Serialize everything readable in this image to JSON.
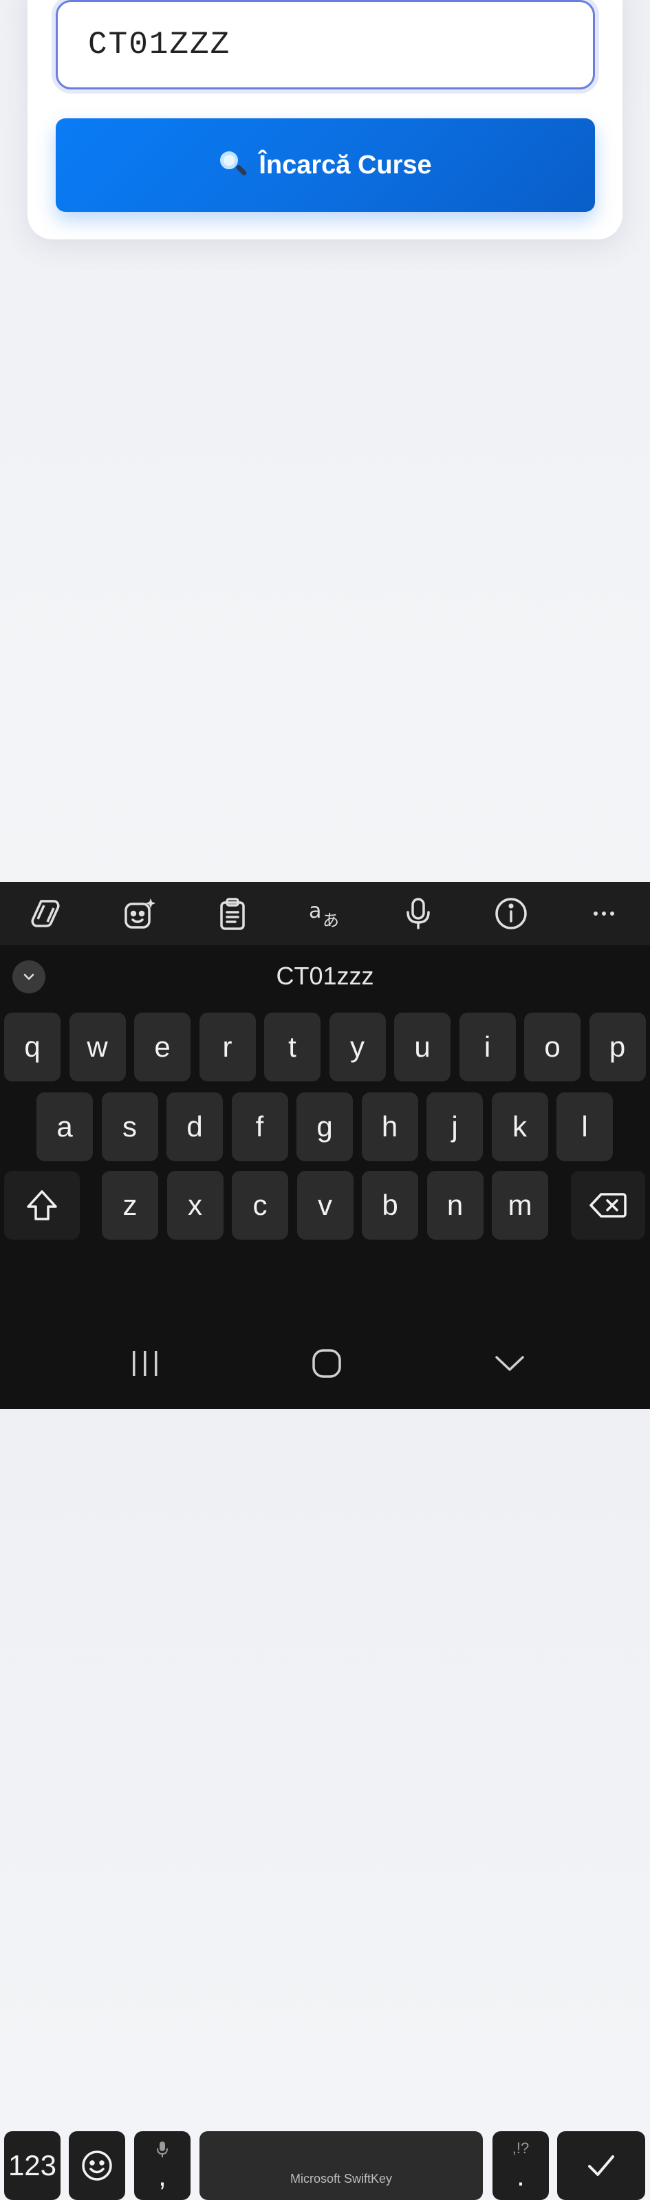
{
  "form": {
    "code_value": "CT01ZZZ",
    "load_button_label": "Încarcă Curse"
  },
  "keyboard": {
    "toolbar_icons": [
      "copilot-icon",
      "sticker-icon",
      "clipboard-icon",
      "translate-icon",
      "microphone-icon",
      "info-icon",
      "more-icon"
    ],
    "suggestion": "CT01zzz",
    "rows": [
      [
        "q",
        "w",
        "e",
        "r",
        "t",
        "y",
        "u",
        "i",
        "o",
        "p"
      ],
      [
        "a",
        "s",
        "d",
        "f",
        "g",
        "h",
        "j",
        "k",
        "l"
      ],
      [
        "z",
        "x",
        "c",
        "v",
        "b",
        "n",
        "m"
      ]
    ],
    "numbers_key": "123",
    "comma_key": ",",
    "space_label": "Microsoft SwiftKey",
    "period_key": ".",
    "period_alt": ",!?"
  },
  "navbar": {
    "buttons": [
      "recent-apps",
      "home",
      "back"
    ]
  },
  "colors": {
    "accent": "#0b6ee0",
    "input_border": "#6a7ee0",
    "keyboard_bg": "#121212",
    "key_bg": "#2c2c2c"
  }
}
